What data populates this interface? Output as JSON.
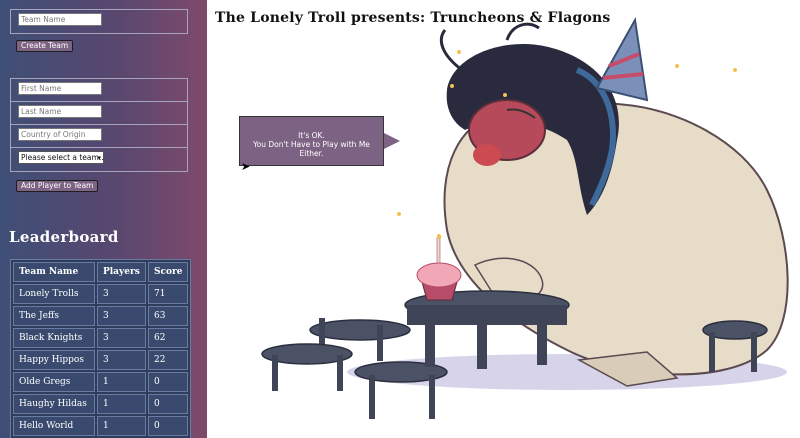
{
  "header": {
    "title": "The Lonely Troll presents: Truncheons & Flagons"
  },
  "team_form": {
    "team_name_placeholder": "Team Name",
    "create_button": "Create Team"
  },
  "player_form": {
    "first_name_placeholder": "First Name",
    "last_name_placeholder": "Last Name",
    "country_placeholder": "Country of Origin",
    "team_select_value": "Please select a team...",
    "add_button": "Add Player to Team"
  },
  "leaderboard": {
    "title": "Leaderboard",
    "columns": [
      "Team Name",
      "Players",
      "Score"
    ],
    "rows": [
      [
        "Lonely Trolls",
        "3",
        "71"
      ],
      [
        "The Jeffs",
        "3",
        "63"
      ],
      [
        "Black Knights",
        "3",
        "62"
      ],
      [
        "Happy Hippos",
        "3",
        "22"
      ],
      [
        "Olde Gregs",
        "1",
        "0"
      ],
      [
        "Haughy Hildas",
        "1",
        "0"
      ],
      [
        "Hello World",
        "1",
        "0"
      ]
    ]
  },
  "speech_bubble": {
    "line1": "It's OK.",
    "line2": "You Don't Have to Play with Me Either."
  },
  "colors": {
    "sidebar_left": "#3f4f77",
    "sidebar_right": "#7e4a6a",
    "accent": "#7d6383"
  }
}
